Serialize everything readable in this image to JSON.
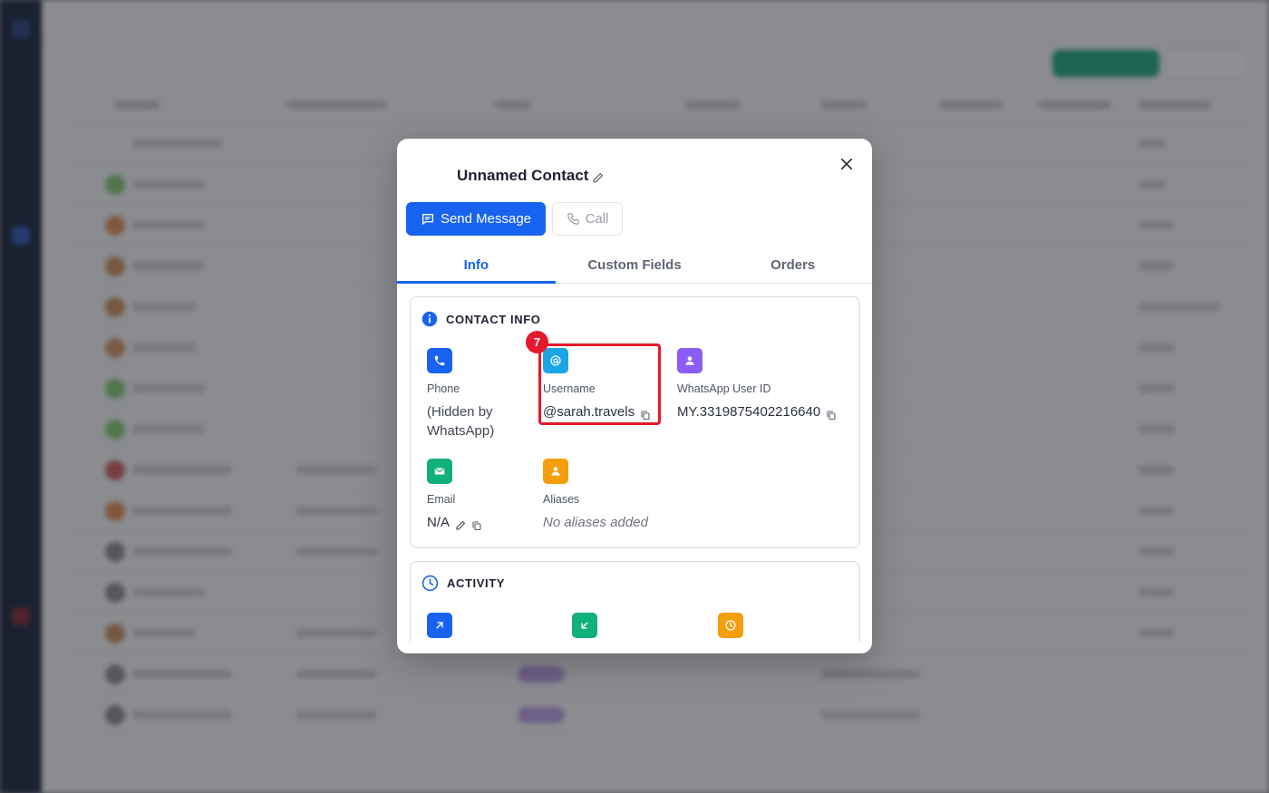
{
  "modal": {
    "title": "Unnamed Contact",
    "send_message_label": "Send Message",
    "call_label": "Call",
    "tabs": [
      {
        "label": "Info",
        "active": true
      },
      {
        "label": "Custom Fields",
        "active": false
      },
      {
        "label": "Orders",
        "active": false
      }
    ]
  },
  "contact_info": {
    "heading": "CONTACT INFO",
    "phone": {
      "label": "Phone",
      "value": "(Hidden by WhatsApp)",
      "icon": "phone-icon",
      "color": "#1763f0"
    },
    "username": {
      "label": "Username",
      "value": "@sarah.travels",
      "icon": "at-icon",
      "color": "#1ba5e6"
    },
    "whatsapp_id": {
      "label": "WhatsApp User ID",
      "value": "MY.3319875402216640",
      "icon": "user-icon",
      "color": "#8b5cf6"
    },
    "email": {
      "label": "Email",
      "value": "N/A",
      "icon": "mail-icon",
      "color": "#12b07a"
    },
    "aliases": {
      "label": "Aliases",
      "value": "No aliases added",
      "icon": "user-icon",
      "color": "#f59e0b"
    }
  },
  "activity": {
    "heading": "ACTIVITY",
    "icons": [
      {
        "icon": "arrow-up-right-icon",
        "color": "#1763f0"
      },
      {
        "icon": "arrow-down-left-icon",
        "color": "#12b07a"
      },
      {
        "icon": "clock-icon",
        "color": "#f59e0b"
      }
    ]
  },
  "annotation": {
    "badge": "7",
    "color": "#e5192b"
  }
}
